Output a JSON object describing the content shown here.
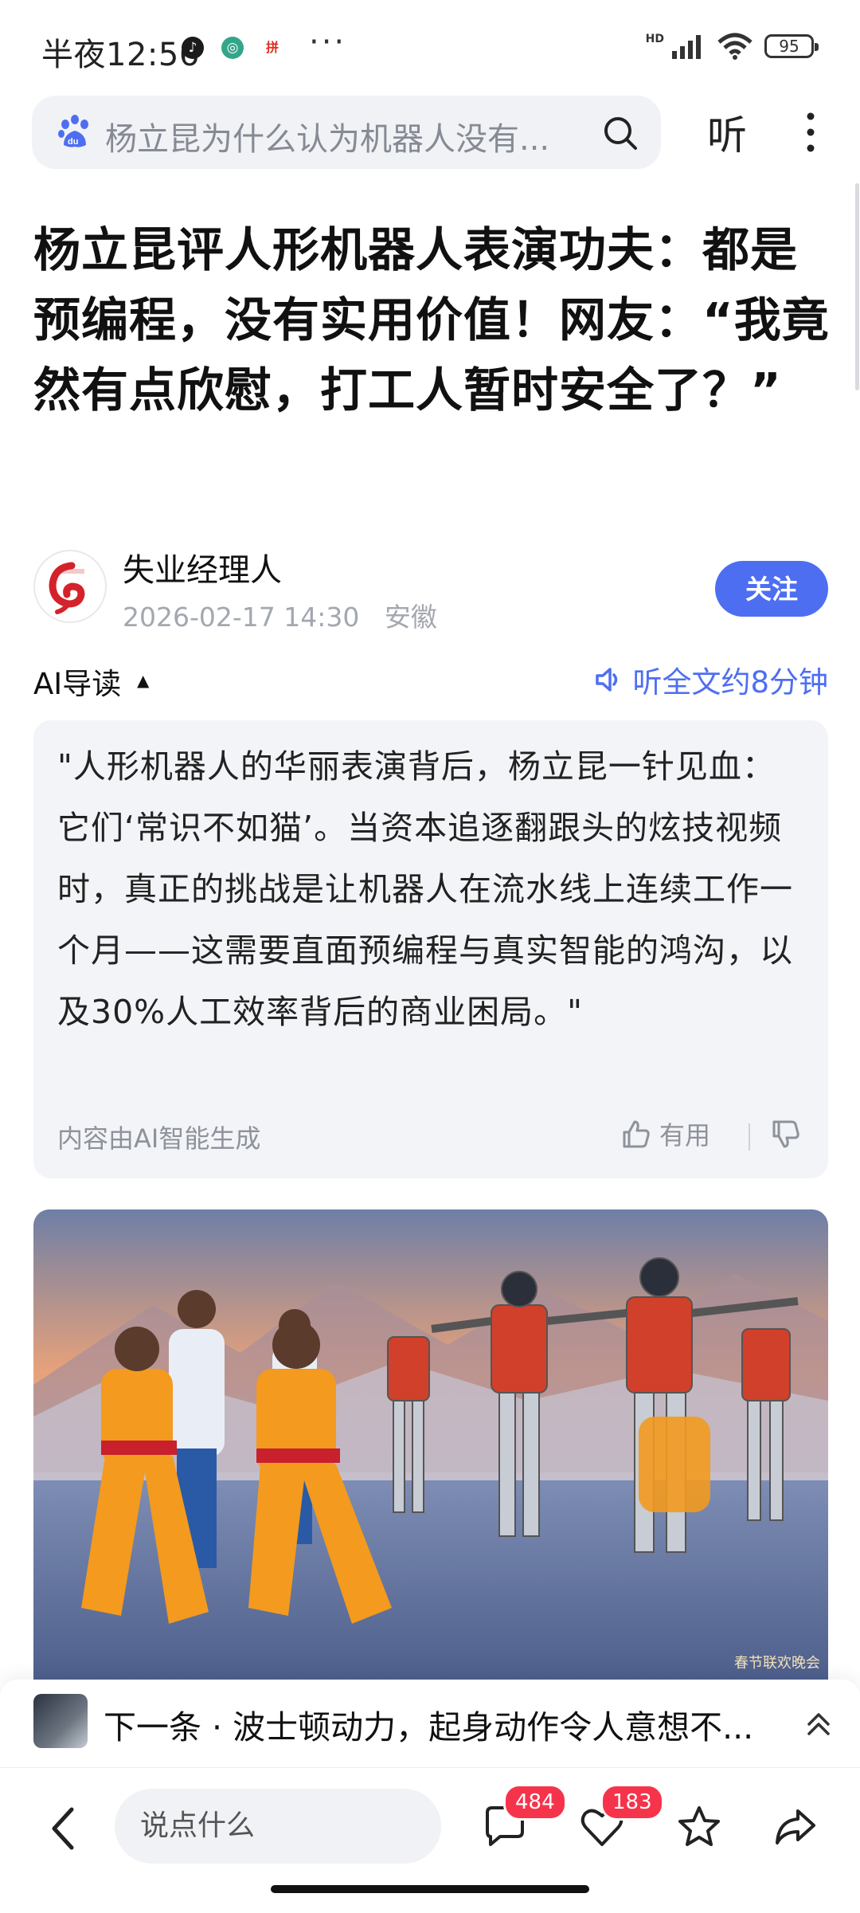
{
  "status_bar": {
    "time": "半夜12:56",
    "app_icon_pin": "拼",
    "more_dots": "···",
    "signal_label": "HD",
    "battery": "95"
  },
  "search": {
    "query": "杨立昆为什么认为机器人没有...",
    "listen_label": "听"
  },
  "article": {
    "title": "杨立昆评人形机器人表演功夫：都是预编程，没有实用价值！网友：“我竟然有点欣慰，打工人暂时安全了？”",
    "author": "失业经理人",
    "datetime": "2026-02-17 14:30",
    "location": "安徽",
    "follow_label": "关注"
  },
  "ai_guide": {
    "label": "AI导读",
    "caret": "▲",
    "listen_full": "听全文约8分钟",
    "summary": "\"人形机器人的华丽表演背后，杨立昆一针见血：它们‘常识不如猫’。当资本追逐翻跟头的炫技视频时，真正的挑战是让机器人在流水线上连续工作一个月——这需要直面预编程与真实智能的鸿沟，以及30%人工效率背后的商业困局。\"",
    "footer": "内容由AI智能生成",
    "useful_label": "有用"
  },
  "hero_image": {
    "watermark": "春节联欢晚会"
  },
  "next": {
    "text": "下一条 · 波士顿动力，起身动作令人意想不..."
  },
  "bottom_bar": {
    "comment_placeholder": "说点什么",
    "comment_count": "484",
    "like_count": "183"
  },
  "colors": {
    "accent": "#4e6ef2",
    "badge": "#f5344b"
  }
}
